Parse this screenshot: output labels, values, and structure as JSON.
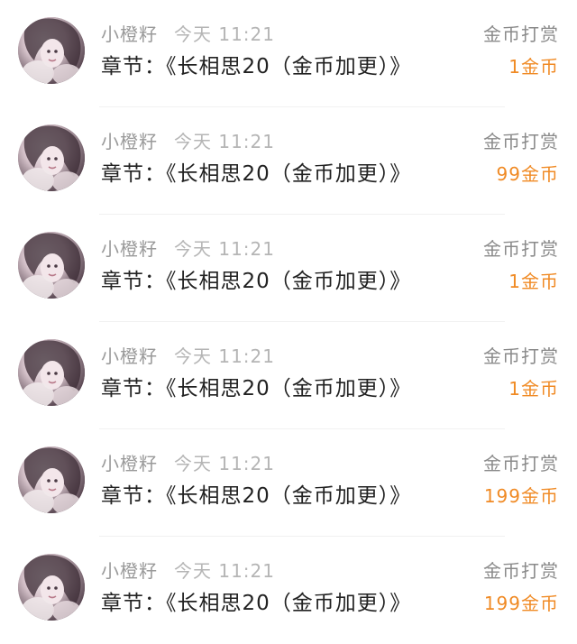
{
  "colors": {
    "name": "#9a9a9a",
    "time": "#b5b5b5",
    "chapter": "#222222",
    "action": "#8a8a8a",
    "amount": "#f08a24"
  },
  "records": [
    {
      "name": "小橙籽",
      "time": "今天 11:21",
      "chapter": "章节：《长相思20（金币加更）》",
      "action": "金币打赏",
      "amount": "1金币",
      "avatar_icon": "user-avatar-icon"
    },
    {
      "name": "小橙籽",
      "time": "今天 11:21",
      "chapter": "章节：《长相思20（金币加更）》",
      "action": "金币打赏",
      "amount": "99金币",
      "avatar_icon": "user-avatar-icon"
    },
    {
      "name": "小橙籽",
      "time": "今天 11:21",
      "chapter": "章节：《长相思20（金币加更）》",
      "action": "金币打赏",
      "amount": "1金币",
      "avatar_icon": "user-avatar-icon"
    },
    {
      "name": "小橙籽",
      "time": "今天 11:21",
      "chapter": "章节：《长相思20（金币加更）》",
      "action": "金币打赏",
      "amount": "1金币",
      "avatar_icon": "user-avatar-icon"
    },
    {
      "name": "小橙籽",
      "time": "今天 11:21",
      "chapter": "章节：《长相思20（金币加更）》",
      "action": "金币打赏",
      "amount": "199金币",
      "avatar_icon": "user-avatar-icon"
    },
    {
      "name": "小橙籽",
      "time": "今天 11:21",
      "chapter": "章节：《长相思20（金币加更）》",
      "action": "金币打赏",
      "amount": "199金币",
      "avatar_icon": "user-avatar-icon"
    }
  ]
}
